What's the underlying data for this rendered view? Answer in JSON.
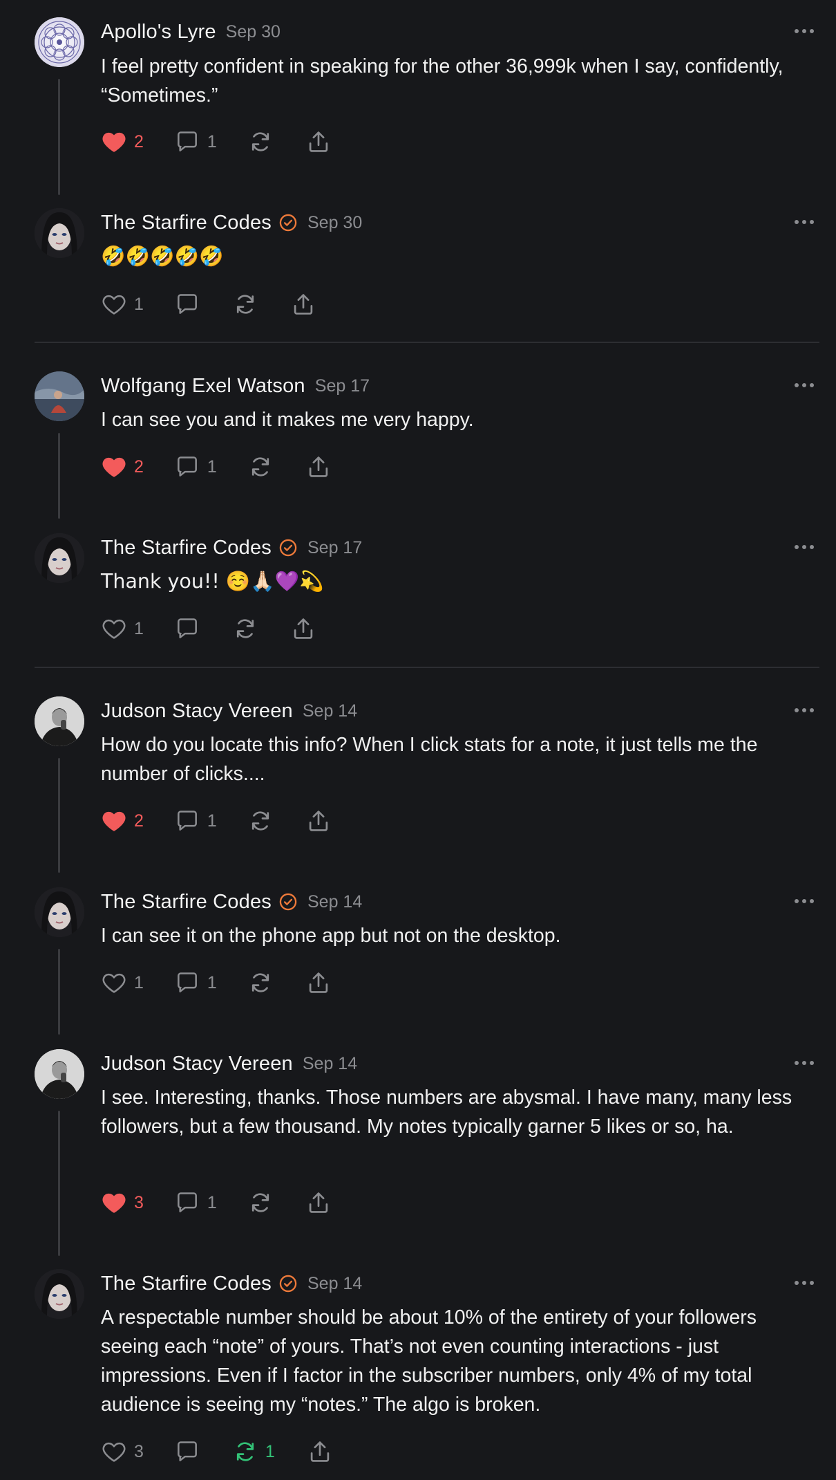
{
  "colors": {
    "background": "#17181b",
    "text": "#f2f2f2",
    "muted": "#8c8d91",
    "like_active": "#f35b5b",
    "restack_active": "#33c277",
    "verified_badge": "#ee7a3a"
  },
  "comments": [
    {
      "name": "Apollo's Lyre",
      "date": "Sep 30",
      "text": "I feel pretty confident in speaking for the other 36,999k when I say, confidently, “Sometimes.”",
      "likes": "2",
      "replies": "1",
      "restacks": "",
      "verified": false
    },
    {
      "name": "The Starfire Codes",
      "date": "Sep 30",
      "text": "🤣🤣🤣🤣🤣",
      "likes": "1",
      "replies": "",
      "restacks": "",
      "verified": true
    },
    {
      "name": "Wolfgang Exel Watson",
      "date": "Sep 17",
      "text": "I can see you and it makes me very happy.",
      "likes": "2",
      "replies": "1",
      "restacks": "",
      "verified": false
    },
    {
      "name": "The Starfire Codes",
      "date": "Sep 17",
      "text": "Thank you!! ☺️🙏🏻💜💫",
      "likes": "1",
      "replies": "",
      "restacks": "",
      "verified": true
    },
    {
      "name": "Judson Stacy Vereen",
      "date": "Sep 14",
      "text": "How do you locate this info? When I click stats for a note, it just tells me the number of clicks....",
      "likes": "2",
      "replies": "1",
      "restacks": "",
      "verified": false
    },
    {
      "name": "The Starfire Codes",
      "date": "Sep 14",
      "text": "I can see it on the phone app but not on the desktop.",
      "likes": "1",
      "replies": "1",
      "restacks": "",
      "verified": true
    },
    {
      "name": "Judson Stacy Vereen",
      "date": "Sep 14",
      "text": "I see. Interesting, thanks. Those numbers are abysmal. I have many, many less followers, but a few thousand. My notes typically garner 5 likes or so, ha.",
      "likes": "3",
      "replies": "1",
      "restacks": "",
      "verified": false
    },
    {
      "name": "The Starfire Codes",
      "date": "Sep 14",
      "text": "A respectable number should be about 10% of the entirety of your followers seeing each “note” of yours. That’s not even counting interactions - just impressions. Even if I factor in the subscriber numbers, only 4% of my total audience is seeing my “notes.” The algo is broken.",
      "likes": "3",
      "replies": "",
      "restacks": "1",
      "verified": true
    }
  ]
}
